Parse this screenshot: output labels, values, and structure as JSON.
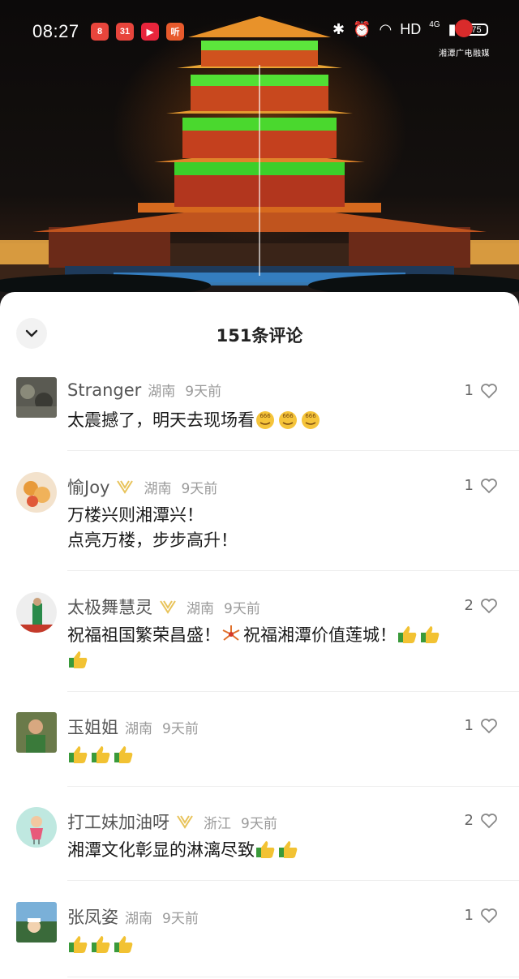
{
  "status_bar": {
    "time": "08:27",
    "app_icons": [
      "8",
      "31",
      "▶",
      "听"
    ],
    "hd_label": "HD",
    "network_label": "4G",
    "battery": "75"
  },
  "watermark": "湘潭广电融媒",
  "sheet": {
    "title": "151条评论",
    "collapse_icon": "chevron-down-icon"
  },
  "colors": {
    "accent_like": "#888888",
    "vip_badge": "#e8c35a",
    "thumb_emoji": "#f2c233"
  },
  "comments": [
    {
      "user": "Stranger",
      "vip": false,
      "location": "湖南",
      "time": "9天前",
      "likes": "1",
      "lines": [
        "太震撼了，明天去现场看"
      ],
      "emoji_after": "666",
      "emoji_count": 3
    },
    {
      "user": "愉Joy",
      "vip": true,
      "location": "湖南",
      "time": "9天前",
      "likes": "1",
      "lines": [
        "万楼兴则湘潭兴！",
        "点亮万楼，步步高升！"
      ]
    },
    {
      "user": "太极舞慧灵",
      "vip": true,
      "location": "湖南",
      "time": "9天前",
      "likes": "2",
      "lines": [
        "祝福祖国繁荣昌盛！",
        "祝福湘潭价值莲城！"
      ],
      "emoji_count": 3
    },
    {
      "user": "玉姐姐",
      "vip": false,
      "location": "湖南",
      "time": "9天前",
      "likes": "1",
      "lines": [],
      "emoji_count": 3
    },
    {
      "user": "打工妹加油呀",
      "vip": true,
      "location": "浙江",
      "time": "9天前",
      "likes": "2",
      "lines": [
        "湘潭文化彰显的淋漓尽致"
      ],
      "emoji_count": 2
    },
    {
      "user": "张凤姿",
      "vip": false,
      "location": "湖南",
      "time": "9天前",
      "likes": "1",
      "lines": [],
      "emoji_count": 3
    }
  ]
}
